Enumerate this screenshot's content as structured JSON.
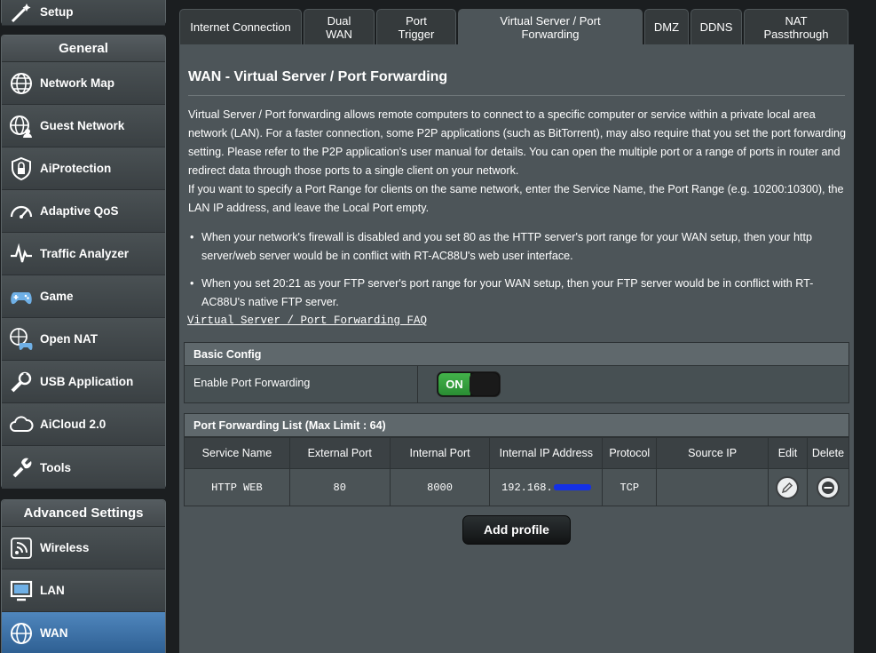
{
  "sidebar": {
    "setup_label": "Setup",
    "general_title": "General",
    "general_items": [
      {
        "label": "Network Map",
        "icon": "globe-network-icon"
      },
      {
        "label": "Guest Network",
        "icon": "globe-guest-icon"
      },
      {
        "label": "AiProtection",
        "icon": "shield-lock-icon"
      },
      {
        "label": "Adaptive QoS",
        "icon": "speedometer-icon"
      },
      {
        "label": "Traffic Analyzer",
        "icon": "pulse-chart-icon"
      },
      {
        "label": "Game",
        "icon": "gamepad-icon"
      },
      {
        "label": "Open NAT",
        "icon": "globe-gamepad-icon"
      },
      {
        "label": "USB Application",
        "icon": "usb-wrench-icon"
      },
      {
        "label": "AiCloud 2.0",
        "icon": "cloud-icon"
      },
      {
        "label": "Tools",
        "icon": "wrench-icon"
      }
    ],
    "advanced_title": "Advanced Settings",
    "advanced_items": [
      {
        "label": "Wireless",
        "icon": "wifi-icon"
      },
      {
        "label": "LAN",
        "icon": "monitor-icon"
      },
      {
        "label": "WAN",
        "icon": "globe-icon",
        "active": true
      }
    ]
  },
  "tabs": [
    {
      "label": "Internet Connection"
    },
    {
      "label": "Dual WAN"
    },
    {
      "label": "Port Trigger"
    },
    {
      "label": "Virtual Server / Port Forwarding",
      "active": true
    },
    {
      "label": "DMZ"
    },
    {
      "label": "DDNS"
    },
    {
      "label": "NAT Passthrough"
    }
  ],
  "main": {
    "title": "WAN - Virtual Server / Port Forwarding",
    "description_1": "Virtual Server / Port forwarding allows remote computers to connect to a specific computer or service within a private local area network (LAN). For a faster connection, some P2P applications (such as BitTorrent), may also require that you set the port forwarding setting. Please refer to the P2P application's user manual for details. You can open the multiple port or a range of ports in router and redirect data through those ports to a single client on your network.",
    "description_2": "If you want to specify a Port Range for clients on the same network, enter the Service Name, the Port Range (e.g. 10200:10300), the LAN IP address, and leave the Local Port empty.",
    "bullets": [
      "When your network's firewall is disabled and you set 80 as the HTTP server's port range for your WAN setup, then your http server/web server would be in conflict with RT-AC88U's web user interface.",
      "When you set 20:21 as your FTP server's port range for your WAN setup, then your FTP server would be in conflict with RT-AC88U's native FTP server."
    ],
    "faq_link": "Virtual Server / Port Forwarding FAQ",
    "basic_config": {
      "title": "Basic Config",
      "enable_label": "Enable Port Forwarding",
      "toggle_text": "ON",
      "toggle_state": true
    },
    "port_list": {
      "title": "Port Forwarding List (Max Limit : 64)",
      "columns": [
        "Service Name",
        "External Port",
        "Internal Port",
        "Internal IP Address",
        "Protocol",
        "Source IP",
        "Edit",
        "Delete"
      ],
      "rows": [
        {
          "service": "HTTP WEB",
          "external": "80",
          "internal": "8000",
          "ip": "192.168.",
          "protocol": "TCP",
          "source": ""
        }
      ]
    },
    "add_button": "Add profile"
  },
  "colors": {
    "active_nav": "#3b72aa",
    "toggle_on": "#35a53d",
    "redaction": "#1430e6"
  }
}
